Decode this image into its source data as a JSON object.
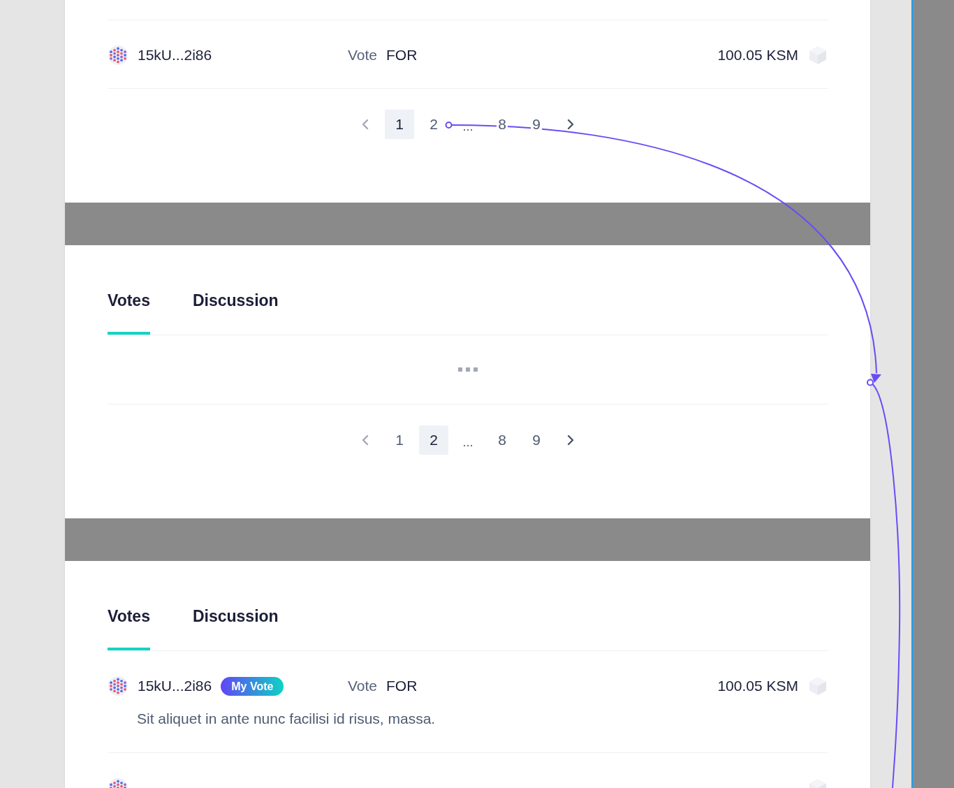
{
  "screens": [
    {
      "rows": [
        {
          "kind": "vote",
          "address": "15kU...2i86",
          "vote_label": "Vote",
          "vote": "FOR",
          "amount": "100.05 KSM"
        }
      ],
      "pagination": {
        "pages": [
          {
            "kind": "page",
            "label": "1",
            "selected": true
          },
          {
            "kind": "page",
            "label": "2",
            "selected": false
          },
          {
            "kind": "gap",
            "label": "..."
          },
          {
            "kind": "page",
            "label": "8",
            "selected": false
          },
          {
            "kind": "page",
            "label": "9",
            "selected": false
          }
        ]
      }
    },
    {
      "tabs": [
        {
          "label": "Votes",
          "selected": true
        },
        {
          "label": "Discussion",
          "selected": false
        }
      ],
      "loading": true,
      "pagination": {
        "pages": [
          {
            "kind": "page",
            "label": "1",
            "selected": false
          },
          {
            "kind": "page",
            "label": "2",
            "selected": true
          },
          {
            "kind": "gap",
            "label": "..."
          },
          {
            "kind": "page",
            "label": "8",
            "selected": false
          },
          {
            "kind": "page",
            "label": "9",
            "selected": false
          }
        ]
      }
    },
    {
      "tabs": [
        {
          "label": "Votes",
          "selected": true
        },
        {
          "label": "Discussion",
          "selected": false
        }
      ],
      "rows": [
        {
          "kind": "vote",
          "address": "15kU...2i86",
          "badge": "My Vote",
          "vote_label": "Vote",
          "vote": "FOR",
          "amount": "100.05 KSM",
          "comment": "Sit aliquet in ante nunc facilisi id risus, massa."
        },
        {
          "kind": "cut"
        }
      ]
    }
  ]
}
